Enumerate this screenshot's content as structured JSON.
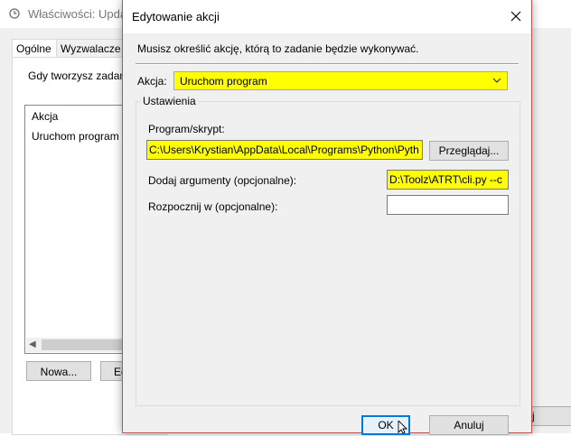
{
  "background_window": {
    "title": "Właściwości: Update",
    "tabs": [
      "Ogólne",
      "Wyzwalacze"
    ],
    "description": "Gdy tworzysz zadani",
    "list": {
      "header": "Akcja",
      "items": [
        "Uruchom program"
      ]
    },
    "buttons": {
      "new_label": "Nowa...",
      "edit_label": "Ed",
      "partial_right_label": "j"
    },
    "icons": {
      "title_icon": "clock-icon",
      "scroll_left": "arrow-left-icon"
    }
  },
  "dialog": {
    "title": "Edytowanie akcji",
    "close_icon": "close-icon",
    "instruction": "Musisz określić akcję, którą to zadanie będzie wykonywać.",
    "action": {
      "label": "Akcja:",
      "value": "Uruchom program",
      "highlight_color": "#ffff00"
    },
    "settings": {
      "legend": "Ustawienia",
      "program_label": "Program/skrypt:",
      "program_value": "C:\\Users\\Krystian\\AppData\\Local\\Programs\\Python\\Pyth",
      "browse_label": "Przeglądaj...",
      "arguments_label": "Dodaj argumenty (opcjonalne):",
      "arguments_value": "D:\\Toolz\\ATRT\\cli.py --c",
      "start_in_label": "Rozpocznij w (opcjonalne):",
      "start_in_value": ""
    },
    "buttons": {
      "ok_label": "OK",
      "cancel_label": "Anuluj"
    },
    "colors": {
      "border": "#c0504d",
      "ok_focus": "#0078d7"
    }
  }
}
